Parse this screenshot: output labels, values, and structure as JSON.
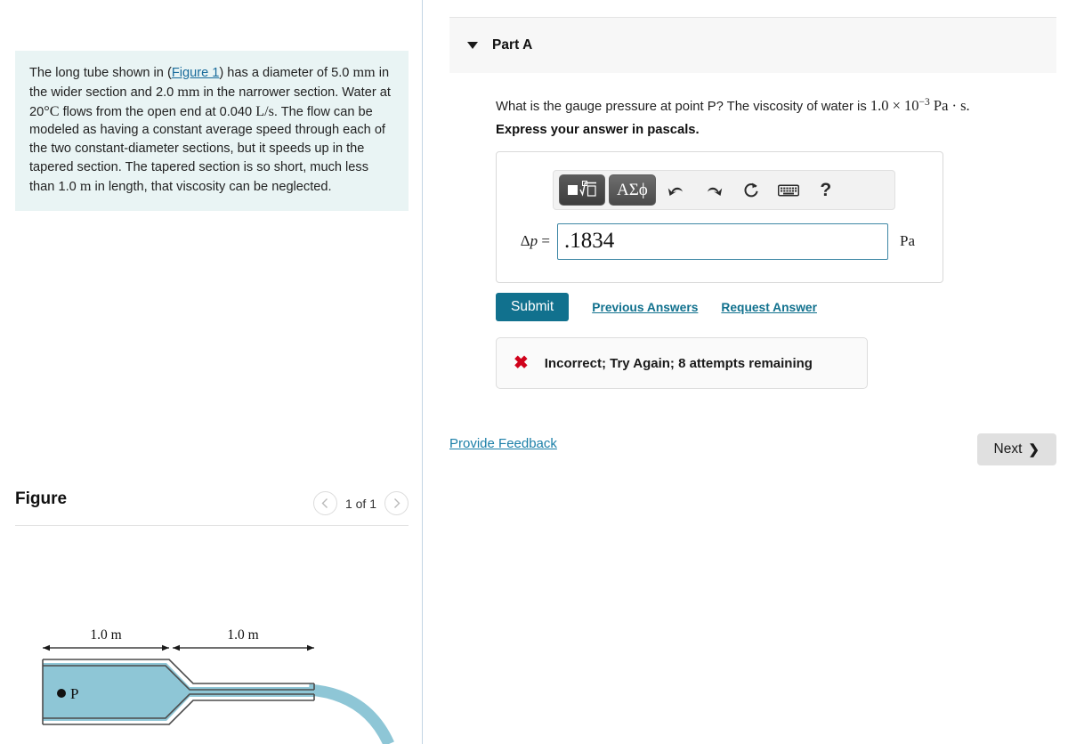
{
  "colors": {
    "accent": "#11718e",
    "link": "#1b7fa8",
    "error": "#d0021b",
    "problem_bg": "#e9f4f4",
    "water": "#8ec6d6",
    "divider": "#c3d5e4"
  },
  "problem": {
    "text_part1": "The long tube shown in (",
    "figure_link": "Figure 1",
    "text_part2": ") has a diameter of 5.0 ",
    "unit_mm_1": "mm",
    "text_part3": " in the wider section and 2.0 ",
    "unit_mm_2": "mm",
    "text_part4": " in the narrower section. Water at 20",
    "degree_c": "°C",
    "text_part5": " flows from the open end at 0.040 ",
    "unit_ls": "L/s",
    "text_part6": ". The flow can be modeled as having a constant average speed through each of the two constant-diameter sections, but it speeds up in the tapered section. The tapered section is so short, much less than 1.0 ",
    "unit_m": "m",
    "text_part7": " in length, that viscosity can be neglected."
  },
  "figure": {
    "title": "Figure",
    "pager_label": "1 of 1",
    "prev_icon": "chevron-left-icon",
    "next_icon": "chevron-right-icon",
    "dim_left_label": "1.0 m",
    "dim_right_label": "1.0 m",
    "point_label": "P"
  },
  "part": {
    "label": "Part A",
    "caret_icon": "caret-down-icon",
    "question_part1": "What is the gauge pressure at point P? The viscosity of water is ",
    "question_value": "1.0 × 10",
    "question_exponent": "−3",
    "question_unit": " Pa · s.",
    "instruction": "Express your answer in pascals."
  },
  "math_toolbar": {
    "sqrt_button": "sqrt-template-button",
    "greek_button_label": "ΑΣϕ",
    "undo_icon": "undo-icon",
    "redo_icon": "redo-icon",
    "reset_icon": "reset-icon",
    "keyboard_icon": "keyboard-icon",
    "help_label": "?"
  },
  "answer": {
    "variable_delta": "Δ",
    "variable_p": "p",
    "equals": "=",
    "value": ".1834",
    "placeholder": "",
    "unit": "Pa"
  },
  "actions": {
    "submit_label": "Submit",
    "previous_answers_label": "Previous Answers",
    "request_answer_label": "Request Answer"
  },
  "feedback": {
    "x_icon": "x-mark-icon",
    "message": "Incorrect; Try Again; 8 attempts remaining"
  },
  "footer": {
    "provide_feedback_label": "Provide Feedback",
    "next_label": "Next",
    "next_icon": "chevron-right-icon"
  }
}
